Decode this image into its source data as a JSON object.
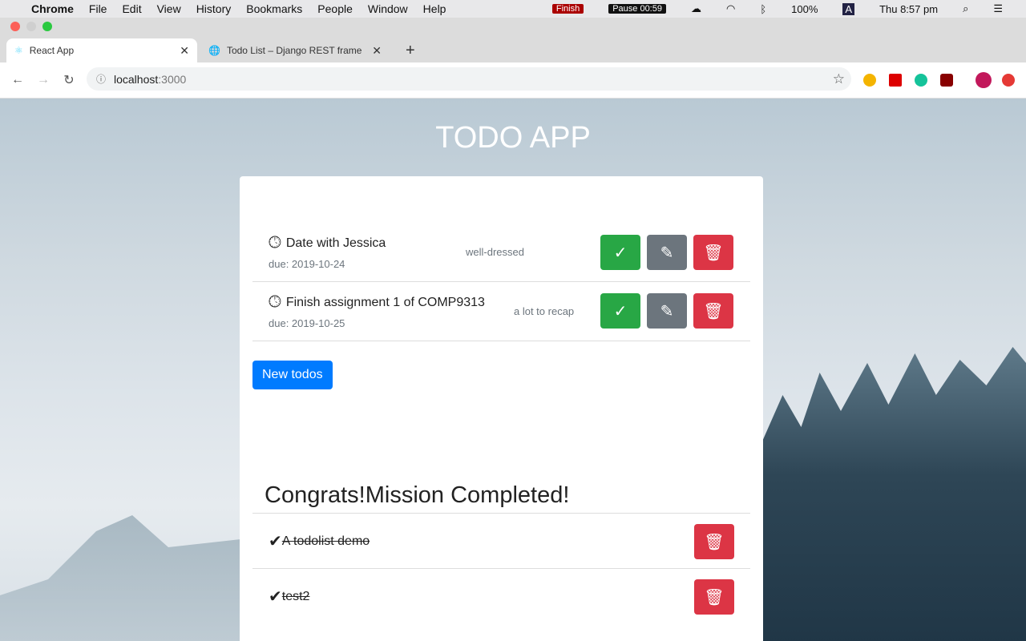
{
  "menubar": {
    "app": "Chrome",
    "items": [
      "File",
      "Edit",
      "View",
      "History",
      "Bookmarks",
      "People",
      "Window",
      "Help"
    ],
    "finish": "Finish",
    "timer": "Pause 00:59",
    "battery": "100%",
    "input": "A",
    "clock": "Thu 8:57 pm"
  },
  "tabs": [
    {
      "label": "React App"
    },
    {
      "label": "Todo List – Django REST frame"
    }
  ],
  "url": {
    "host": "localhost",
    "port": ":3000"
  },
  "app": {
    "title": "TODO APP",
    "new_button": "New todos",
    "completed_heading": "Congrats!Mission Completed!"
  },
  "todos": [
    {
      "title": "Date with Jessica",
      "due": "due: 2019-10-24",
      "description": "well-dressed"
    },
    {
      "title": "Finish assignment 1 of COMP9313",
      "due": "due: 2019-10-25",
      "description": "a lot to recap"
    }
  ],
  "completed": [
    {
      "title": " A todolist demo"
    },
    {
      "title": " test2"
    }
  ],
  "colors": {
    "success": "#28a745",
    "secondary": "#6c757d",
    "danger": "#dc3545",
    "primary": "#007bff"
  }
}
